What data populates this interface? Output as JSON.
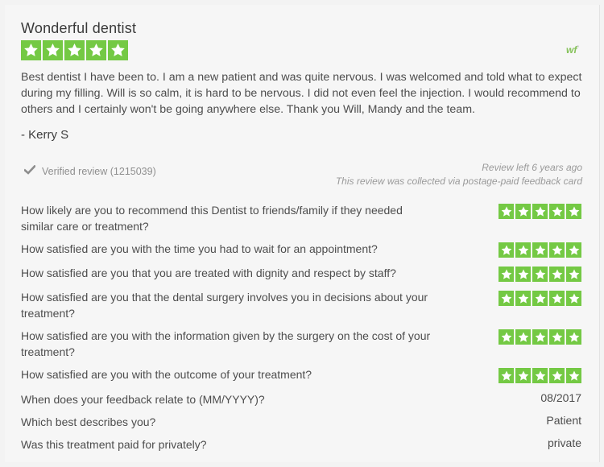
{
  "review": {
    "title": "Wonderful dentist",
    "rating": 5,
    "logo_text": "wf",
    "logo_sup": "*",
    "body": "Best dentist I have been to. I am a new patient and was quite nervous. I was welcomed and told what to expect during my filling. Will is so calm, it is hard to be nervous. I did not even feel the injection. I would recommend to others and I certainly won't be going anywhere else. Thank you Will, Mandy and the team.",
    "author": "- Kerry S",
    "verified": "Verified review (1215039)",
    "left_ago": "Review left 6 years ago",
    "collected": "This review was collected via postage-paid feedback card"
  },
  "questions": [
    {
      "text": "How likely are you to recommend this Dentist to friends/family if they needed similar care or treatment?",
      "rating": 5
    },
    {
      "text": "How satisfied are you with the time you had to wait for an appointment?",
      "rating": 5
    },
    {
      "text": "How satisfied are you that you are treated with dignity and respect by staff?",
      "rating": 5
    },
    {
      "text": "How satisfied are you that the dental surgery involves you in decisions about your treatment?",
      "rating": 5
    },
    {
      "text": "How satisfied are you with the information given by the surgery on the cost of your treatment?",
      "rating": 5
    },
    {
      "text": "How satisfied are you with the outcome of your treatment?",
      "rating": 5
    },
    {
      "text": "When does your feedback relate to (MM/YYYY)?",
      "answer": "08/2017"
    },
    {
      "text": "Which best describes you?",
      "answer": "Patient"
    },
    {
      "text": "Was this treatment paid for privately?",
      "answer": "private"
    }
  ],
  "colors": {
    "star_bg": "#74c944",
    "star": "#ffffff"
  }
}
